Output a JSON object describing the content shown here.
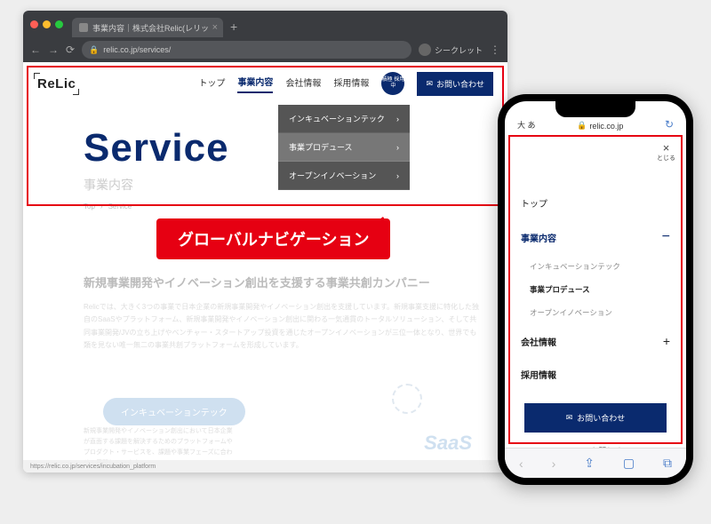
{
  "browser": {
    "tab_title": "事業内容｜株式会社Relic(レリッ",
    "url": "relic.co.jp/services/",
    "incognito_label": "シークレット",
    "status_url": "https://relic.co.jp/services/incubation_platform"
  },
  "header": {
    "logo": "ReLic",
    "nav": [
      {
        "label": "トップ"
      },
      {
        "label": "事業内容",
        "active": true
      },
      {
        "label": "会社情報"
      },
      {
        "label": "採用情報"
      }
    ],
    "badge": "積極\n採用中",
    "contact": "お問い合わせ"
  },
  "dropdown": [
    {
      "label": "インキュベーションテック"
    },
    {
      "label": "事業プロデュース",
      "selected": true
    },
    {
      "label": "オープンイノベーション"
    }
  ],
  "hero": {
    "title": "Service",
    "subtitle": "事業内容",
    "breadcrumbs": [
      "Top",
      "Service"
    ]
  },
  "callout": "グローバルナビゲーション",
  "intro": {
    "heading": "新規事業開発やイノベーション創出を支援する事業共創カンパニー",
    "body": "Relicでは、大きく3つの事業で日本企業の新規事業開発やイノベーション創出を支援しています。新規事業支援に特化した独自のSaaSやプラットフォーム、新規事業開発やイノベーション創出に関わる一気通貫のトータルソリューション、そして共同事業開発/JVの立ち上げやベンチャー・スタートアップ投資を通じたオープンイノベーションが三位一体となり、世界でも類を見ない唯一無二の事業共創プラットフォームを形成しています。"
  },
  "pill": {
    "label": "インキュベーションテック",
    "desc": "新規事業開発やイノベーション創出において日本企業が直面する課題を解決するためのプラットフォームやプロダクト・サービスを、課題や事業フェーズに合わせて展開しています。"
  },
  "saas_label": "SaaS",
  "mobile": {
    "size_label": "大 あ",
    "url": "relic.co.jp",
    "close_label": "とじる",
    "menu": [
      {
        "label": "トップ",
        "type": "item"
      },
      {
        "label": "事業内容",
        "type": "blue",
        "icon": "minus"
      },
      {
        "label": "インキュベーションテック",
        "type": "sub"
      },
      {
        "label": "事業プロデュース",
        "type": "sub-sel"
      },
      {
        "label": "オープンイノベーション",
        "type": "sub"
      },
      {
        "label": "会社情報",
        "type": "bold",
        "icon": "plus"
      },
      {
        "label": "採用情報",
        "type": "bold"
      }
    ],
    "contact": "お問い合わせ",
    "close_menu": "メニューを閉じる"
  }
}
